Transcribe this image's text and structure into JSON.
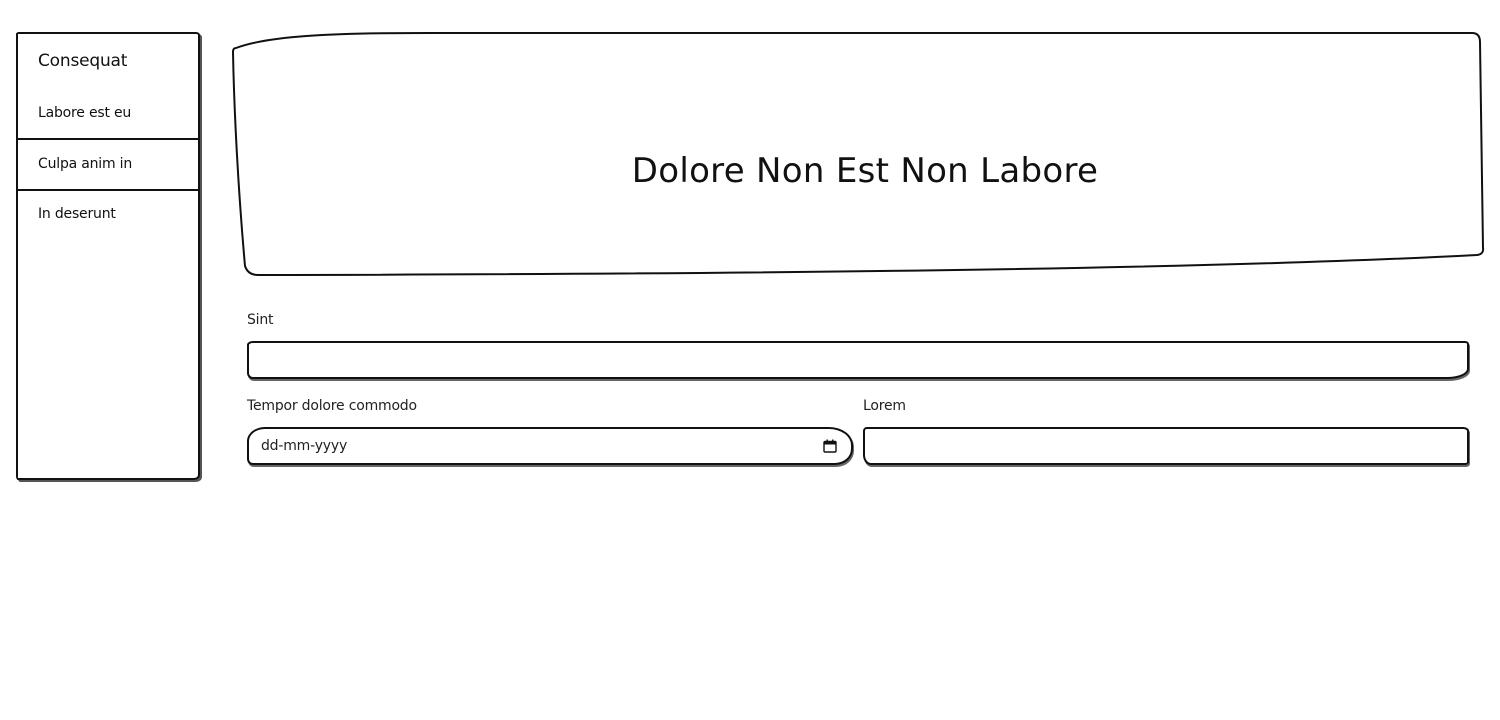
{
  "sidebar": {
    "title": "Consequat",
    "items": [
      {
        "label": "Labore est eu"
      },
      {
        "label": "Culpa anim in"
      },
      {
        "label": "In deserunt"
      }
    ]
  },
  "hero": {
    "title": "Dolore Non Est Non Labore"
  },
  "form": {
    "sint": {
      "label": "Sint",
      "value": ""
    },
    "tempor": {
      "label": "Tempor dolore commodo",
      "placeholder": "dd-mm-yyyy"
    },
    "lorem": {
      "label": "Lorem",
      "value": ""
    }
  },
  "icons": {
    "date_picker": "calendar-icon"
  }
}
